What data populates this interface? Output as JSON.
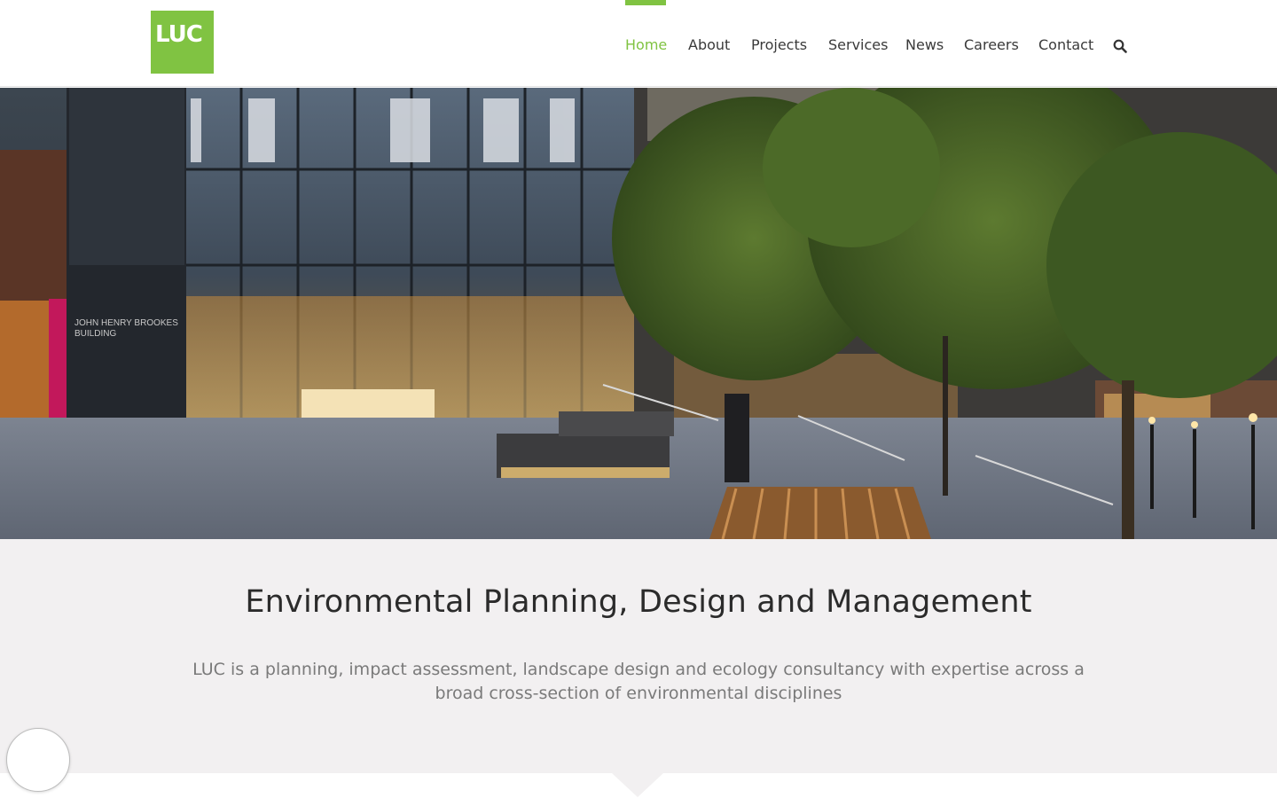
{
  "logo": {
    "text": "LUC"
  },
  "nav": {
    "items": [
      {
        "label": "Home",
        "active": true
      },
      {
        "label": "About"
      },
      {
        "label": "Projects"
      },
      {
        "label": "Services"
      },
      {
        "label": "News"
      },
      {
        "label": "Careers"
      },
      {
        "label": "Contact"
      }
    ],
    "search_icon": "search-icon"
  },
  "hero": {
    "building_sign_line1": "JOHN HENRY BROOKES",
    "building_sign_line2": "BUILDING"
  },
  "tagline": {
    "title": "Environmental Planning, Design and Management",
    "description": "LUC is a planning, impact assessment, landscape design and ecology consultancy with expertise across a broad cross-section of environmental disciplines"
  },
  "colors": {
    "brand_green": "#80c342",
    "section_bg": "#f2f0f1"
  }
}
